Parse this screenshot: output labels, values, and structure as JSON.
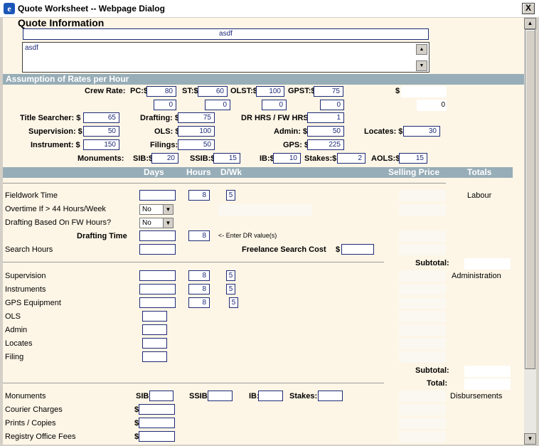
{
  "window": {
    "title": "Quote Worksheet -- Webpage Dialog",
    "close_label": "X"
  },
  "quote": {
    "heading": "Quote Information",
    "name_value": "asdf",
    "notes_value": "asdf"
  },
  "rates": {
    "heading": "Assumption of Rates per Hour",
    "crew_rate_label": "Crew Rate:",
    "pc_label": "PC:$",
    "pc_value": "80",
    "st_label": "ST:$",
    "st_value": "60",
    "olst_label": "OLST:$",
    "olst_value": "100",
    "gpst_label": "GPST:$",
    "gpst_value": "75",
    "dollar_label": "$",
    "row2": [
      "0",
      "0",
      "0",
      "0"
    ],
    "row2_total": "0",
    "title_searcher_label": "Title Searcher: $",
    "title_searcher_value": "65",
    "drafting_label": "Drafting: $",
    "drafting_value": "75",
    "dr_hrs_label": "DR HRS / FW HRS:",
    "dr_hrs_value": "1",
    "supervision_label": "Supervision: $",
    "supervision_value": "50",
    "ols_label": "OLS: $",
    "ols_value": "100",
    "admin_label": "Admin: $",
    "admin_value": "50",
    "locates_label": "Locates: $",
    "locates_value": "30",
    "instrument_label": "Instrument: $",
    "instrument_value": "150",
    "filings_label": "Filings: $",
    "filings_value": "50",
    "gps_label": "GPS: $",
    "gps_value": "225",
    "monuments_label": "Monuments:",
    "sib_label": "SIB:$",
    "sib_value": "20",
    "ssib_label": "SSIB:$",
    "ssib_value": "15",
    "ib_label": "IB:$",
    "ib_value": "10",
    "stakes_label": "Stakes:$",
    "stakes_value": "2",
    "aols_label": "AOLS:$",
    "aols_value": "15"
  },
  "columns": {
    "days": "Days",
    "hours": "Hours",
    "dwk": "D/Wk",
    "selling_price": "Selling Price",
    "totals": "Totals"
  },
  "labour": {
    "fieldwork_label": "Fieldwork Time",
    "fieldwork_hours": "8",
    "fieldwork_dwk": "5",
    "section_label": "Labour",
    "overtime_label": "Overtime If > 44 Hours/Week",
    "overtime_value": "No",
    "drafting_based_label": "Drafting Based On FW Hours?",
    "drafting_based_value": "No",
    "drafting_time_label": "Drafting Time",
    "drafting_time_hours": "8",
    "dr_hint": "<- Enter DR value(s)",
    "search_hours_label": "Search Hours",
    "freelance_label": "Freelance Search Cost",
    "freelance_dollar": "$",
    "subtotal_label": "Subtotal:"
  },
  "administration": {
    "section_label": "Administration",
    "supervision_label": "Supervision",
    "supervision_hours": "8",
    "supervision_dwk": "5",
    "instruments_label": "Instruments",
    "instruments_hours": "8",
    "instruments_dwk": "5",
    "gps_label": "GPS Equipment",
    "gps_hours": "8",
    "gps_dwk": "5",
    "ols_label": "OLS",
    "admin_label": "Admin",
    "locates_label": "Locates",
    "filing_label": "Filing",
    "subtotal_label": "Subtotal:",
    "total_label": "Total:"
  },
  "disbursements": {
    "section_label": "Disbursements",
    "monuments_label": "Monuments",
    "sib_label": "SIB:",
    "ssib_label": "SSIB:",
    "ib_label": "IB:",
    "stakes_label": "Stakes:",
    "courier_label": "Courier Charges",
    "prints_label": "Prints / Copies",
    "registry_label": "Registry Office Fees",
    "dollar": "$"
  },
  "colors": {
    "section_bar": "#97adb7",
    "content_bg": "#fdf5e6",
    "input_border": "#1e2a78"
  },
  "icons": {
    "app": "ie-icon",
    "scroll_up": "arrow-up-icon",
    "scroll_down": "arrow-down-icon"
  }
}
